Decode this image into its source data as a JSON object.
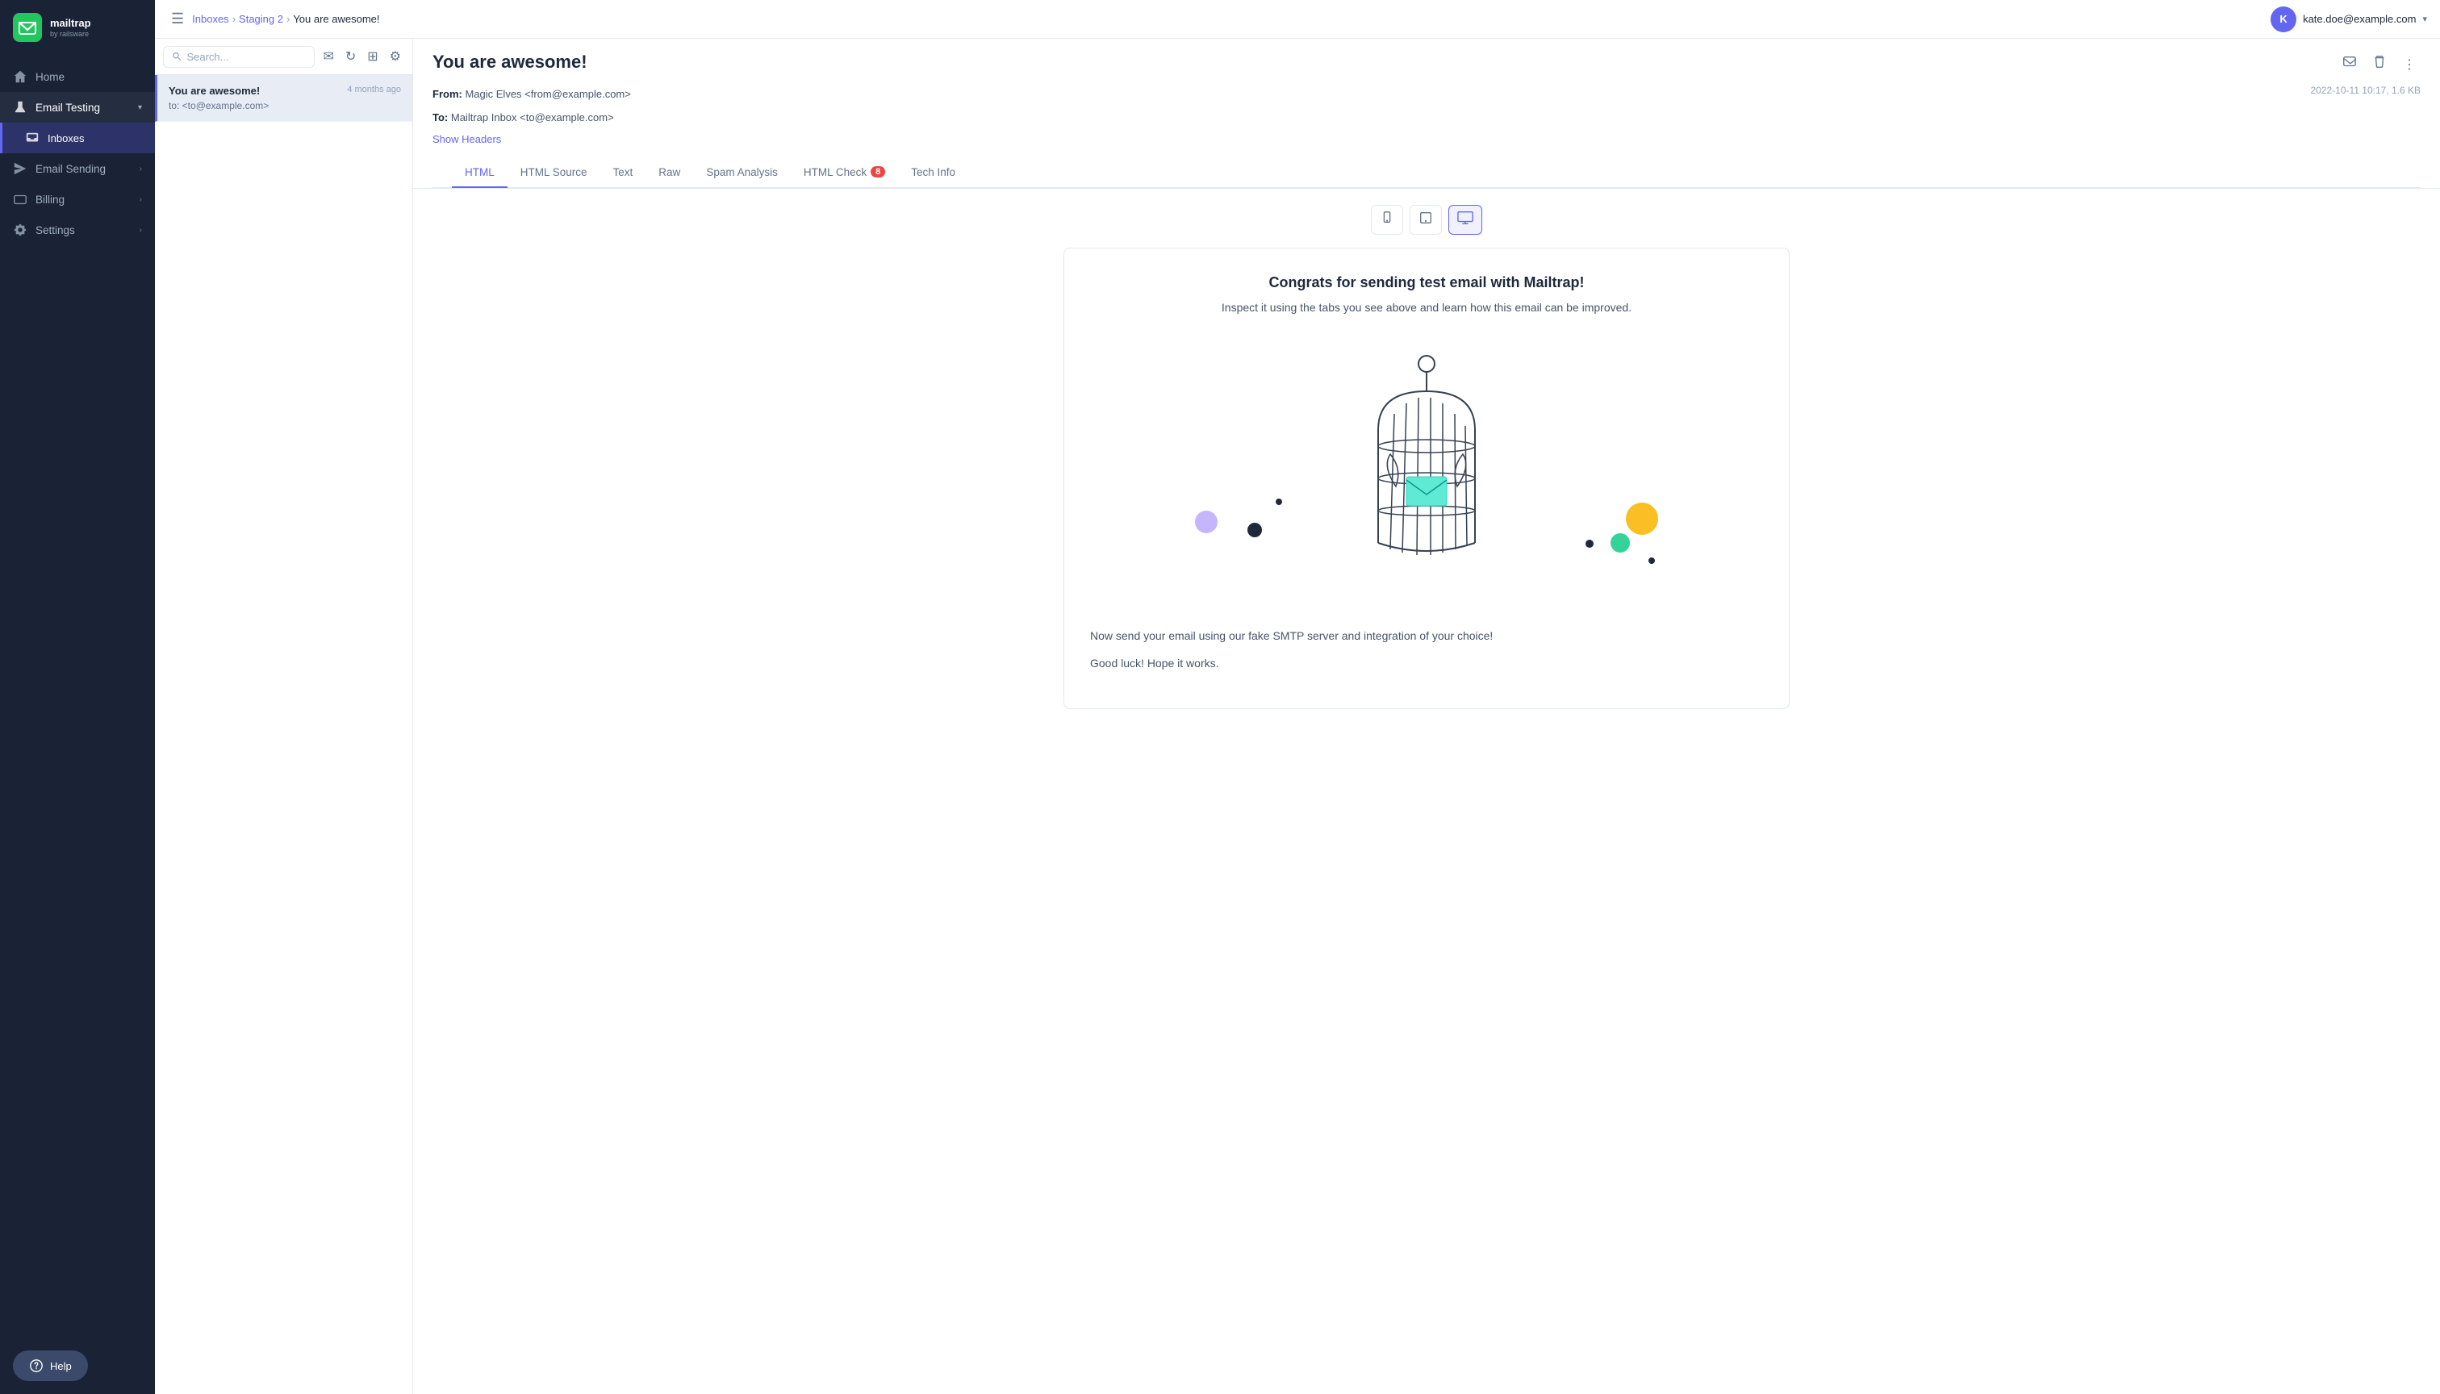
{
  "sidebar": {
    "logo": {
      "brand": "mailtrap",
      "sub": "by railsware"
    },
    "items": [
      {
        "id": "home",
        "label": "Home",
        "icon": "home",
        "active": false
      },
      {
        "id": "email-testing",
        "label": "Email Testing",
        "icon": "flask",
        "active": true,
        "expanded": true
      },
      {
        "id": "inboxes",
        "label": "Inboxes",
        "icon": "inbox",
        "active": true,
        "sub": true
      },
      {
        "id": "email-sending",
        "label": "Email Sending",
        "icon": "send",
        "active": false,
        "hasChevron": true
      },
      {
        "id": "billing",
        "label": "Billing",
        "icon": "credit-card",
        "active": false,
        "hasChevron": true
      },
      {
        "id": "settings",
        "label": "Settings",
        "icon": "gear",
        "active": false,
        "hasChevron": true
      }
    ],
    "help_label": "Help"
  },
  "topbar": {
    "breadcrumb": {
      "inboxes": "Inboxes",
      "staging": "Staging 2",
      "current": "You are awesome!"
    },
    "user": {
      "name": "kate.doe@example.com",
      "initial": "K"
    }
  },
  "email_list": {
    "search_placeholder": "Search...",
    "emails": [
      {
        "subject": "You are awesome!",
        "to": "to: <to@example.com>",
        "time": "4 months ago",
        "active": true
      }
    ]
  },
  "email_detail": {
    "subject": "You are awesome!",
    "from_label": "From:",
    "from_value": "Magic Elves <from@example.com>",
    "to_label": "To:",
    "to_value": "Mailtrap Inbox <to@example.com>",
    "date": "2022-10-11 10:17, 1.6 KB",
    "show_headers": "Show Headers",
    "tabs": [
      {
        "id": "html",
        "label": "HTML",
        "active": true
      },
      {
        "id": "html-source",
        "label": "HTML Source",
        "active": false
      },
      {
        "id": "text",
        "label": "Text",
        "active": false
      },
      {
        "id": "raw",
        "label": "Raw",
        "active": false
      },
      {
        "id": "spam-analysis",
        "label": "Spam Analysis",
        "active": false
      },
      {
        "id": "html-check",
        "label": "HTML Check",
        "badge": "8",
        "active": false
      },
      {
        "id": "tech-info",
        "label": "Tech Info",
        "active": false
      }
    ],
    "preview": {
      "title": "Congrats for sending test email with Mailtrap!",
      "subtitle": "Inspect it using the tabs you see above and learn how this email can be improved.",
      "body1": "Now send your email using our fake SMTP server and integration of your choice!",
      "body2": "Good luck! Hope it works."
    }
  }
}
